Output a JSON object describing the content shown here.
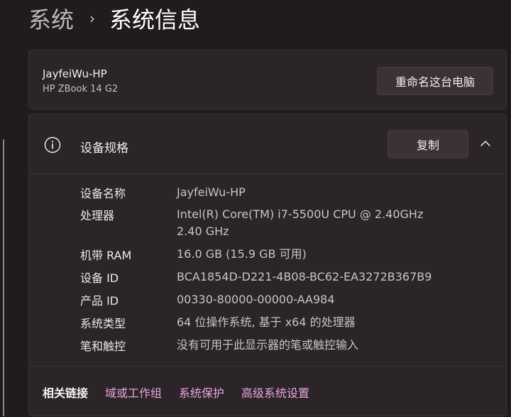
{
  "breadcrumb": {
    "parent": "系统",
    "separator": "›",
    "current": "系统信息"
  },
  "device": {
    "name": "JayfeiWu-HP",
    "model": "HP ZBook 14 G2",
    "rename_button": "重命名这台电脑"
  },
  "specs": {
    "title": "设备规格",
    "icon": "info-icon",
    "copy_button": "复制",
    "collapse_icon": "chevron-up-icon",
    "rows": [
      {
        "label": "设备名称",
        "value": "JayfeiWu-HP"
      },
      {
        "label": "处理器",
        "value": "Intel(R) Core(TM) i7-5500U CPU @ 2.40GHz   2.40 GHz"
      },
      {
        "label": "机带 RAM",
        "value": "16.0 GB (15.9 GB 可用)"
      },
      {
        "label": "设备 ID",
        "value": "BCA1854D-D221-4B08-BC62-EA3272B367B9"
      },
      {
        "label": "产品 ID",
        "value": "00330-80000-00000-AA984"
      },
      {
        "label": "系统类型",
        "value": "64 位操作系统, 基于 x64 的处理器"
      },
      {
        "label": "笔和触控",
        "value": "没有可用于此显示器的笔或触控输入"
      }
    ]
  },
  "related_links": {
    "label": "相关链接",
    "links": [
      "域或工作组",
      "系统保护",
      "高级系统设置"
    ]
  },
  "colors": {
    "background": "#211a1f",
    "card": "#2b2428",
    "link_accent": "#eaa6dd"
  }
}
